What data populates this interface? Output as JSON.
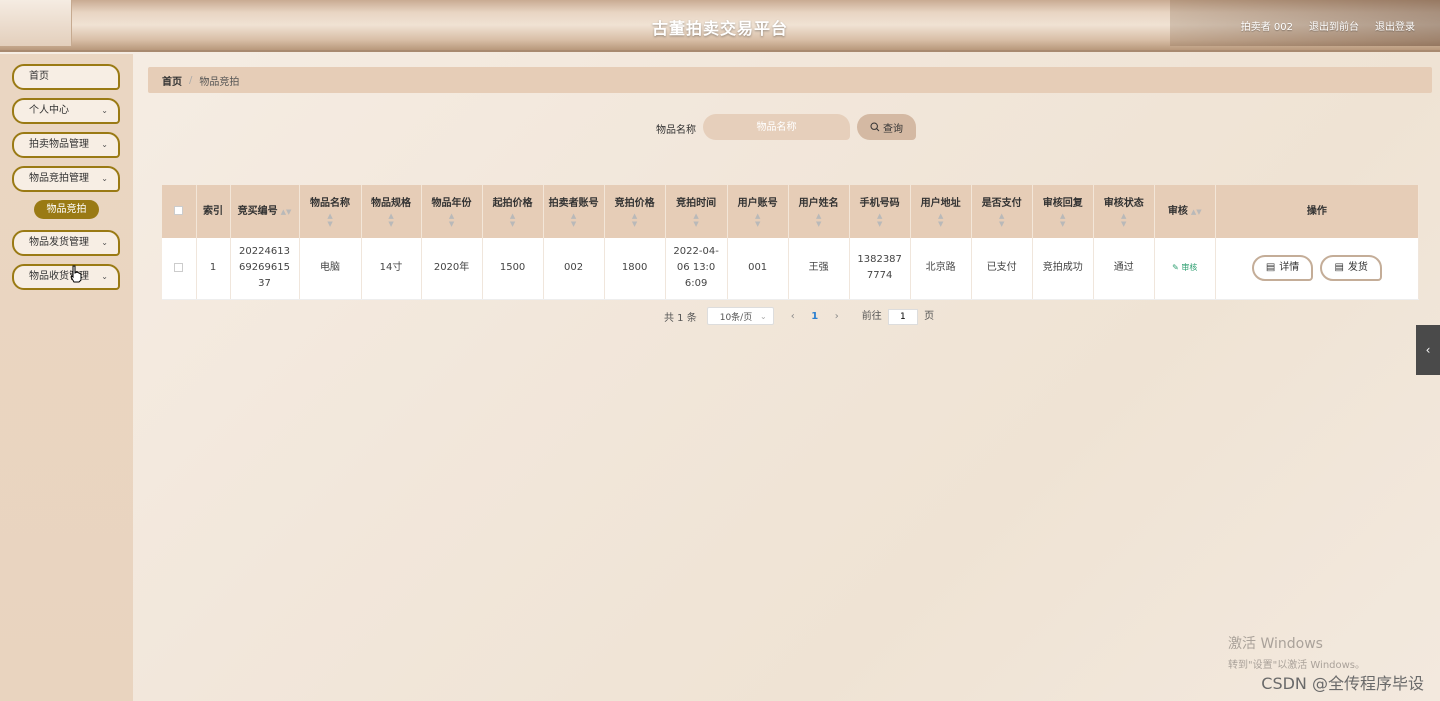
{
  "header": {
    "title": "古董拍卖交易平台",
    "user": "拍卖者 002",
    "back_front": "退出到前台",
    "logout": "退出登录"
  },
  "sidebar": {
    "items": [
      {
        "label": "首页"
      },
      {
        "label": "个人中心"
      },
      {
        "label": "拍卖物品管理"
      },
      {
        "label": "物品竞拍管理"
      },
      {
        "label": "物品发货管理"
      },
      {
        "label": "物品收货管理"
      }
    ],
    "active_sub": "物品竞拍"
  },
  "breadcrumb": {
    "home": "首页",
    "sep": "/",
    "current": "物品竞拍"
  },
  "search": {
    "label": "物品名称",
    "placeholder": "物品名称",
    "button": "查询"
  },
  "table": {
    "headers": [
      "索引",
      "竞买编号",
      "物品名称",
      "物品规格",
      "物品年份",
      "起拍价格",
      "拍卖者账号",
      "竞拍价格",
      "竞拍时间",
      "用户账号",
      "用户姓名",
      "手机号码",
      "用户地址",
      "是否支付",
      "审核回复",
      "审核状态",
      "审核",
      "操作"
    ],
    "rows": [
      {
        "index": "1",
        "bid_no": "202246136926961537",
        "name": "电脑",
        "spec": "14寸",
        "year": "2020年",
        "start_price": "1500",
        "seller": "002",
        "bid_price": "1800",
        "bid_time": "2022-04-06 13:06:09",
        "user_account": "001",
        "user_name": "王强",
        "phone": "13823877774",
        "address": "北京路",
        "paid": "已支付",
        "reply": "竞拍成功",
        "status": "通过",
        "audit": "审核",
        "detail": "详情",
        "ship": "发货"
      }
    ]
  },
  "pager": {
    "total": "共 1 条",
    "size": "10条/页",
    "page": "1",
    "goto": "前往",
    "page_unit": "页"
  },
  "watermark": {
    "line1": "激活 Windows",
    "line2": "转到\"设置\"以激活 Windows。",
    "csdn": "CSDN @全传程序毕设"
  }
}
